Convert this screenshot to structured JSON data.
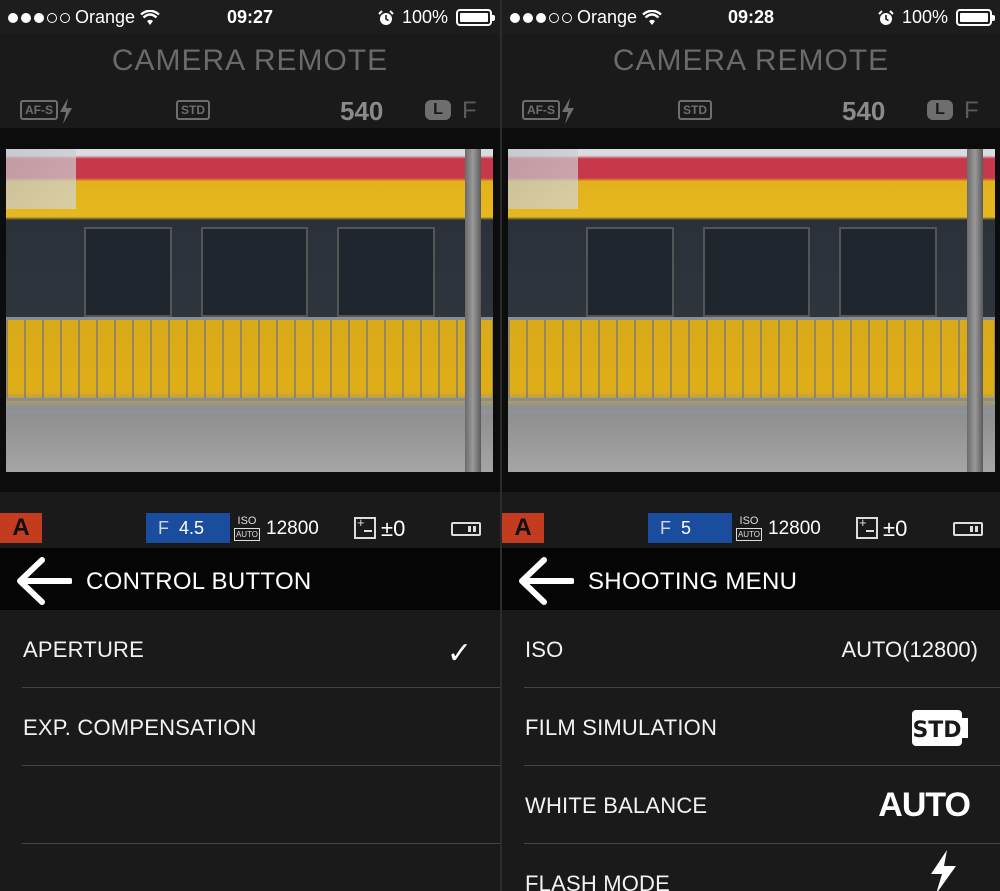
{
  "screens": [
    {
      "status": {
        "carrier": "Orange",
        "time": "09:27",
        "battery": "100%"
      },
      "app_title": "CAMERA REMOTE",
      "camera_status": {
        "af_mode": "AF-S",
        "film": "STD",
        "shots": "540",
        "size": "L",
        "quality": "F"
      },
      "exposure": {
        "mode": "A",
        "f_label": "F",
        "f_value": "4.5",
        "iso_label": "ISO",
        "iso_auto": "AUTO",
        "iso_value": "12800",
        "ev_value": "±0"
      },
      "nav": {
        "title": "CONTROL BUTTON"
      },
      "rows": [
        {
          "label": "APERTURE",
          "checked": true
        },
        {
          "label": "EXP. COMPENSATION"
        },
        {
          "label": ""
        }
      ]
    },
    {
      "status": {
        "carrier": "Orange",
        "time": "09:28",
        "battery": "100%"
      },
      "app_title": "CAMERA REMOTE",
      "camera_status": {
        "af_mode": "AF-S",
        "film": "STD",
        "shots": "540",
        "size": "L",
        "quality": "F"
      },
      "exposure": {
        "mode": "A",
        "f_label": "F",
        "f_value": "5",
        "iso_label": "ISO",
        "iso_auto": "AUTO",
        "iso_value": "12800",
        "ev_value": "±0"
      },
      "nav": {
        "title": "SHOOTING MENU"
      },
      "rows": [
        {
          "label": "ISO",
          "value": "AUTO(12800)"
        },
        {
          "label": "FILM SIMULATION",
          "badge": "STD"
        },
        {
          "label": "WHITE BALANCE",
          "badge": "AUTO"
        },
        {
          "label": "FLASH MODE"
        }
      ]
    }
  ],
  "colors": {
    "mode_badge": "#c33c20",
    "aperture_box": "#1a4d9d",
    "navbar": "#050505",
    "list_bg": "#1a1a1a"
  },
  "icons": [
    "wifi-icon",
    "alarm-icon",
    "battery-icon",
    "flash-icon",
    "back-arrow-icon",
    "checkmark-icon",
    "std-film-icon"
  ]
}
